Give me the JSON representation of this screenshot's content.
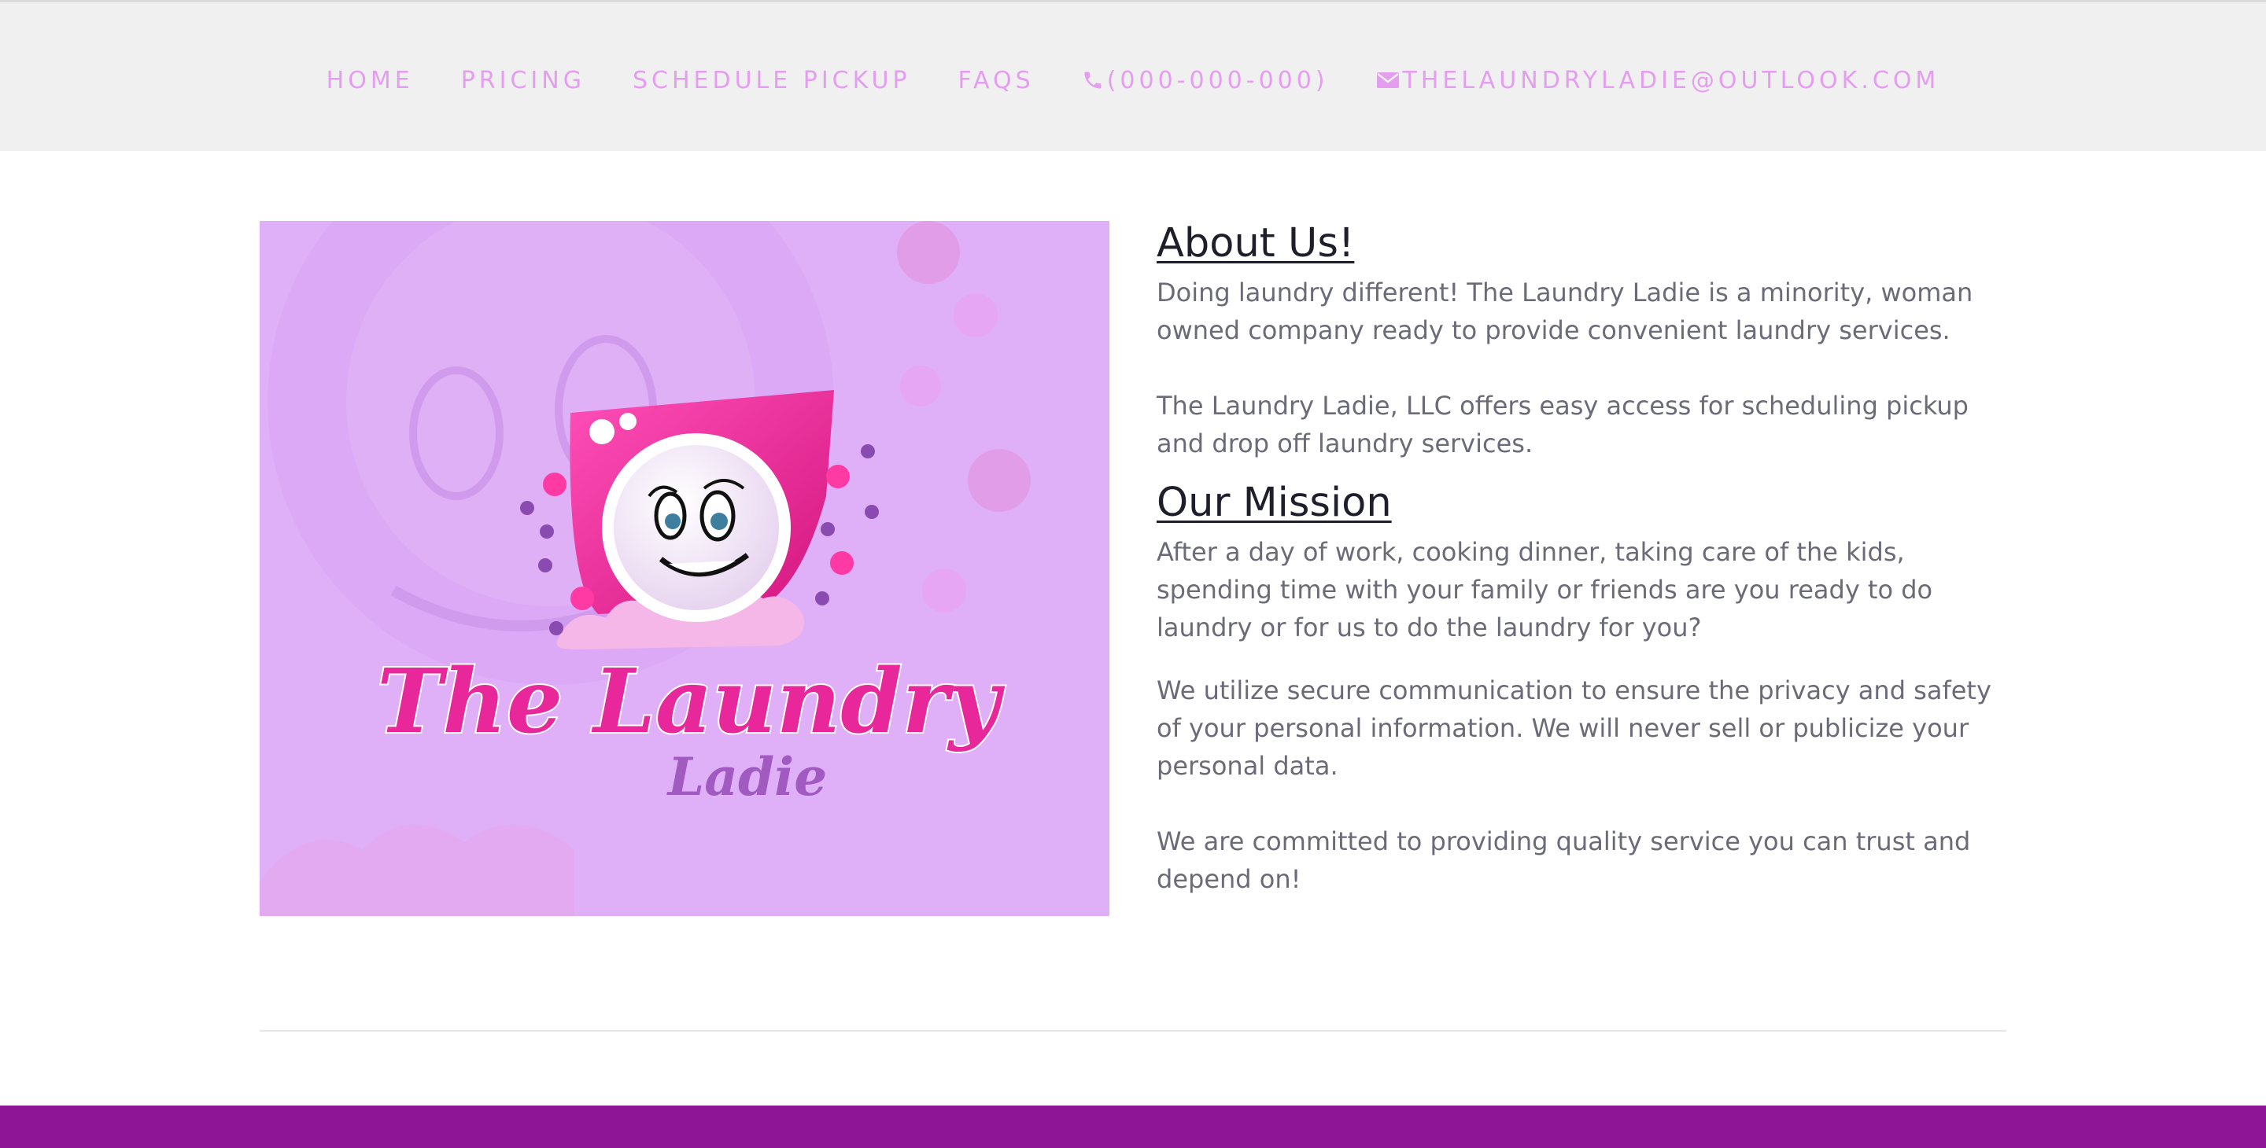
{
  "nav": {
    "home": "HOME",
    "pricing": "PRICING",
    "schedule": "SCHEDULE PICKUP",
    "faqs": "FAQS",
    "phone": "(000-000-000)",
    "email": "THELAUNDRYLADIE@OUTLOOK.COM",
    "phone_icon": "phone-icon",
    "email_icon": "envelope-icon"
  },
  "logo": {
    "line1": "The Laundry",
    "line2": "Ladie"
  },
  "about": {
    "heading": "About Us!",
    "p1": "Doing laundry different! The Laundry Ladie is a minority, woman owned company ready to provide convenient laundry services.",
    "p2": "The Laundry Ladie, LLC offers easy access for scheduling pickup and drop off laundry services."
  },
  "mission": {
    "heading": "Our Mission",
    "p1": "After a day of work, cooking dinner, taking care of the kids, spending time with your family or friends are you ready to do laundry or for us to do the laundry for you?",
    "p2": "We utilize secure communication to ensure the privacy and safety of your personal information. We will never sell or publicize your personal data.",
    "p3": "We are committed to providing quality service you can trust and depend on!"
  },
  "colors": {
    "nav_text": "#e49ef0",
    "footer": "#8d1596",
    "image_bg": "#dfb0f8",
    "logo_pink": "#e8289a"
  }
}
